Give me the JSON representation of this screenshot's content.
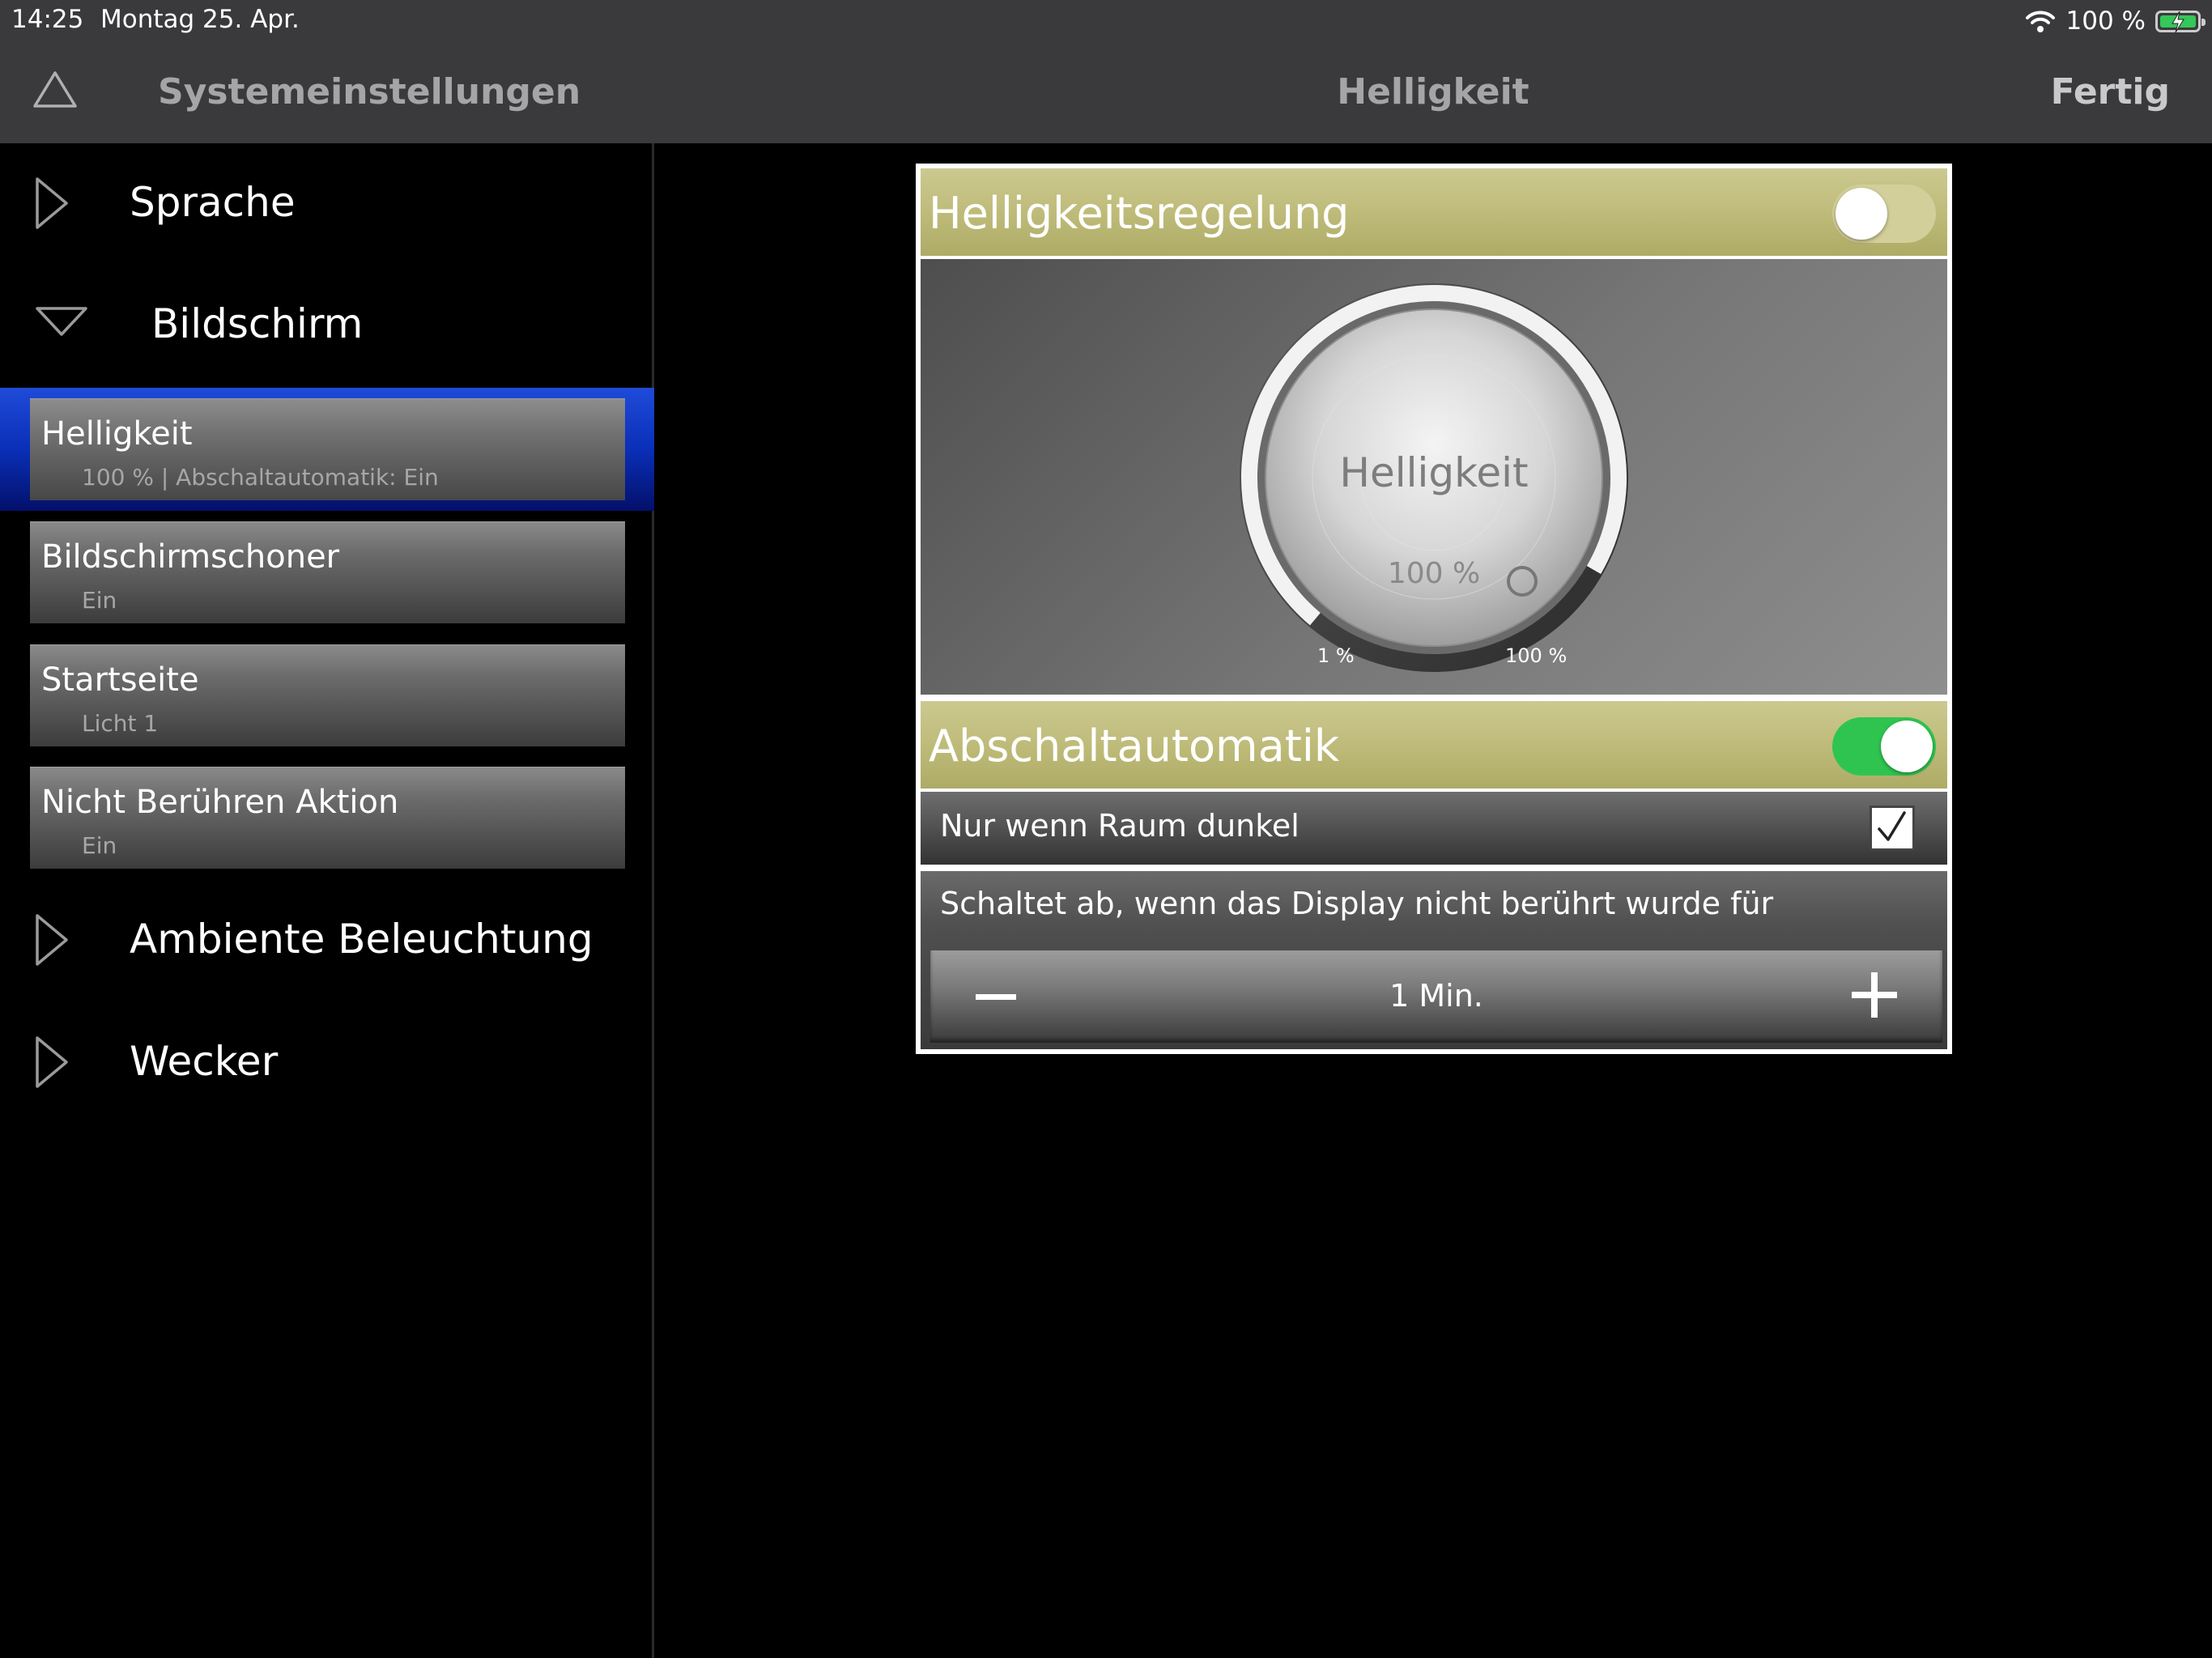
{
  "status_bar": {
    "time": "14:25",
    "date": "Montag 25. Apr.",
    "battery_percent": "100 %",
    "battery_level": 1.0,
    "icons": [
      "wifi-icon",
      "battery-charging-icon"
    ]
  },
  "nav": {
    "up_icon": "triangle-up-icon",
    "back_title": "Systemeinstellungen",
    "title": "Helligkeit",
    "done": "Fertig"
  },
  "sidebar": {
    "sections": [
      {
        "label": "Sprache",
        "expanded": false
      },
      {
        "label": "Bildschirm",
        "expanded": true
      },
      {
        "label": "Ambiente Beleuchtung",
        "expanded": false
      },
      {
        "label": "Wecker",
        "expanded": false
      }
    ],
    "items": [
      {
        "title": "Helligkeit",
        "subtitle": "100 % | Abschaltautomatik: Ein",
        "selected": true
      },
      {
        "title": "Bildschirmschoner",
        "subtitle": "Ein",
        "selected": false
      },
      {
        "title": "Startseite",
        "subtitle": "Licht 1",
        "selected": false
      },
      {
        "title": "Nicht Berühren Aktion",
        "subtitle": "Ein",
        "selected": false
      }
    ],
    "selection_color": "#0a2fb8"
  },
  "panel": {
    "brightness_control": {
      "label": "Helligkeitsregelung",
      "enabled": false
    },
    "dial": {
      "label": "Helligkeit",
      "value": "100 %",
      "level": 1.0,
      "min_label": "1 %",
      "max_label": "100 %"
    },
    "auto_off": {
      "label": "Abschaltautomatik",
      "enabled": true,
      "toggle_color": "#2fc450"
    },
    "only_dark": {
      "label": "Nur wenn Raum dunkel",
      "checked": true
    },
    "timeout": {
      "label": "Schaltet ab, wenn das Display nicht berührt wurde für",
      "value": "1 Min."
    },
    "header_color": "#bdba78"
  }
}
